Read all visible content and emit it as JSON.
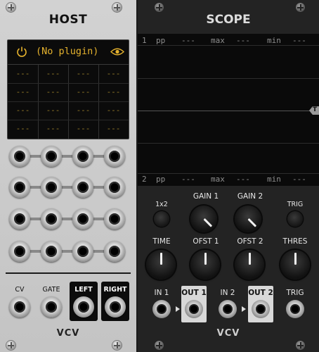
{
  "host": {
    "title": "HOST",
    "plugin_name": "(No plugin)",
    "param_grid": [
      [
        "---",
        "---",
        "---",
        "---"
      ],
      [
        "---",
        "---",
        "---",
        "---"
      ],
      [
        "---",
        "---",
        "---",
        "---"
      ],
      [
        "---",
        "---",
        "---",
        "---"
      ]
    ],
    "io_labels": {
      "cv": "CV",
      "gate": "GATE",
      "left": "LEFT",
      "right": "RIGHT"
    },
    "logo": "VCV"
  },
  "scope": {
    "title": "SCOPE",
    "ch1": {
      "num": "1",
      "pp": "pp",
      "pp_val": "---",
      "max": "max",
      "max_val": "---",
      "min": "min",
      "min_val": "---"
    },
    "ch2": {
      "num": "2",
      "pp": "pp",
      "pp_val": "---",
      "max": "max",
      "max_val": "---",
      "min": "min",
      "min_val": "---"
    },
    "trigger_marker": "T",
    "controls": {
      "x1x2": "1x2",
      "gain1": "GAIN 1",
      "gain2": "GAIN 2",
      "trig": "TRIG",
      "time": "TIME",
      "ofst1": "OFST 1",
      "ofst2": "OFST 2",
      "thres": "THRES"
    },
    "jacks": {
      "in1": "IN 1",
      "out1": "OUT 1",
      "in2": "IN 2",
      "out2": "OUT 2",
      "trig": "TRIG"
    },
    "logo": "VCV"
  },
  "colors": {
    "host_panel": "#c8c8c8",
    "scope_panel": "#232323",
    "display_text": "#e6b32e",
    "screen": "#0a0a0a"
  }
}
